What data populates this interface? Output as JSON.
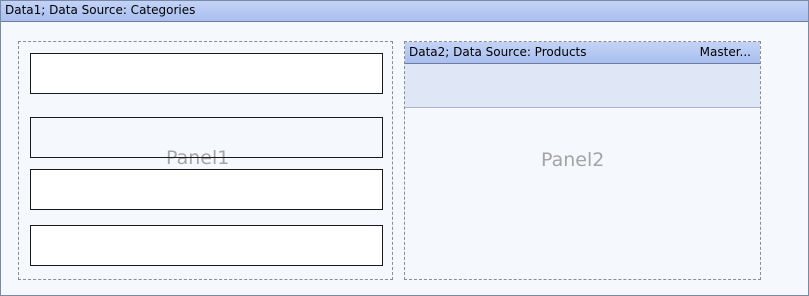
{
  "band1": {
    "title": "Data1; Data Source: Categories"
  },
  "panel1": {
    "label": "Panel1",
    "fields": [
      "",
      "",
      "",
      ""
    ]
  },
  "panel2": {
    "label": "Panel2",
    "detail": {
      "title": "Data2; Data Source: Products",
      "master_label": "Master..."
    }
  },
  "colors": {
    "header_gradient_top": "#c3d3f7",
    "header_gradient_bottom": "#a9bfef",
    "band_background": "#f5f8fd",
    "detail_band_background": "#dfe7f7",
    "panel_label_color": "#a4a4a4"
  }
}
